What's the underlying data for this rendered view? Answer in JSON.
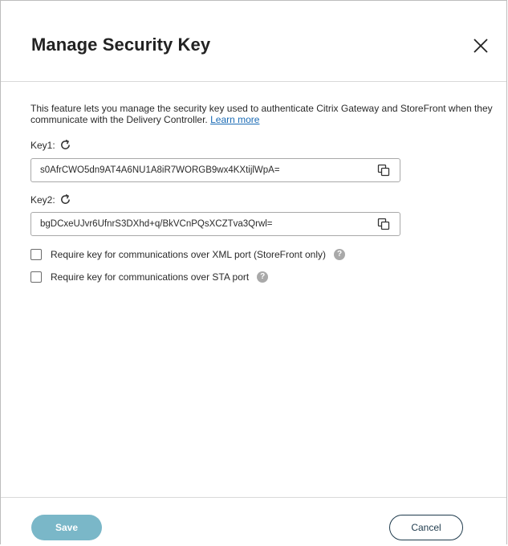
{
  "dialog": {
    "title": "Manage Security Key",
    "description": "This feature lets you manage the security key used to authenticate Citrix Gateway and StoreFront when they communicate with the Delivery Controller.",
    "learn_more": "Learn more"
  },
  "keys": [
    {
      "label": "Key1:",
      "value": "s0AfrCWO5dn9AT4A6NU1A8iR7WORGB9wx4KXtijlWpA="
    },
    {
      "label": "Key2:",
      "value": "bgDCxeUJvr6UfnrS3DXhd+q/BkVCnPQsXCZTva3Qrwl="
    }
  ],
  "options": [
    {
      "label": "Require key for communications over XML port (StoreFront only)",
      "checked": false
    },
    {
      "label": "Require key for communications over STA port",
      "checked": false
    }
  ],
  "footer": {
    "save_label": "Save",
    "cancel_label": "Cancel"
  },
  "icons": {
    "close": "close-icon",
    "refresh": "refresh-icon",
    "copy": "copy-icon",
    "help": "help-icon"
  },
  "colors": {
    "save_button_bg": "#7ab7c8",
    "cancel_border": "#1f3b4d",
    "link": "#1a6bb5",
    "help_icon": "#a9a9a9"
  }
}
